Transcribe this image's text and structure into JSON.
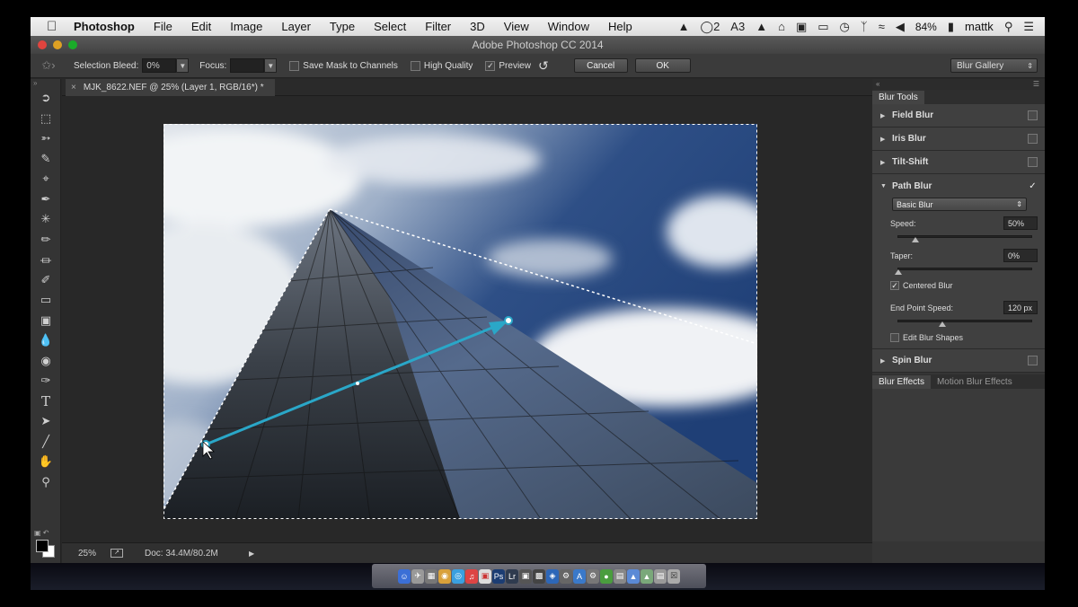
{
  "menubar": {
    "items": [
      "Photoshop",
      "File",
      "Edit",
      "Image",
      "Layer",
      "Type",
      "Select",
      "Filter",
      "3D",
      "View",
      "Window",
      "Help"
    ],
    "status": {
      "cc_count": "2",
      "adobe_count": "3",
      "battery": "84%",
      "user": "mattk"
    }
  },
  "window": {
    "title": "Adobe Photoshop CC 2014"
  },
  "options": {
    "selection_bleed_label": "Selection Bleed:",
    "selection_bleed_value": "0%",
    "focus_label": "Focus:",
    "focus_value": "",
    "save_mask_label": "Save Mask to Channels",
    "high_quality_label": "High Quality",
    "preview_label": "Preview",
    "preview_checked": true,
    "cancel_label": "Cancel",
    "ok_label": "OK",
    "gallery_label": "Blur Gallery"
  },
  "document": {
    "tab_title": "MJK_8622.NEF @ 25% (Layer 1, RGB/16*) *",
    "zoom": "25%",
    "doc_size": "Doc: 34.4M/80.2M"
  },
  "panel": {
    "tab": "Blur Tools",
    "sections": {
      "field": "Field Blur",
      "iris": "Iris Blur",
      "tilt": "Tilt-Shift",
      "path": "Path Blur",
      "spin": "Spin Blur"
    },
    "path_blur": {
      "type": "Basic Blur",
      "speed_label": "Speed:",
      "speed_value": "50%",
      "speed_level": 0.5,
      "taper_label": "Taper:",
      "taper_value": "0%",
      "taper_level": 0,
      "centered_label": "Centered Blur",
      "endpoint_label": "End Point Speed:",
      "endpoint_value": "120 px",
      "edit_shapes_label": "Edit Blur Shapes"
    },
    "effects_tabs": [
      "Blur Effects",
      "Motion Blur Effects"
    ]
  },
  "colors": {
    "accent": "#2aa7c8",
    "foreground": "#000000",
    "background": "#ffffff"
  }
}
